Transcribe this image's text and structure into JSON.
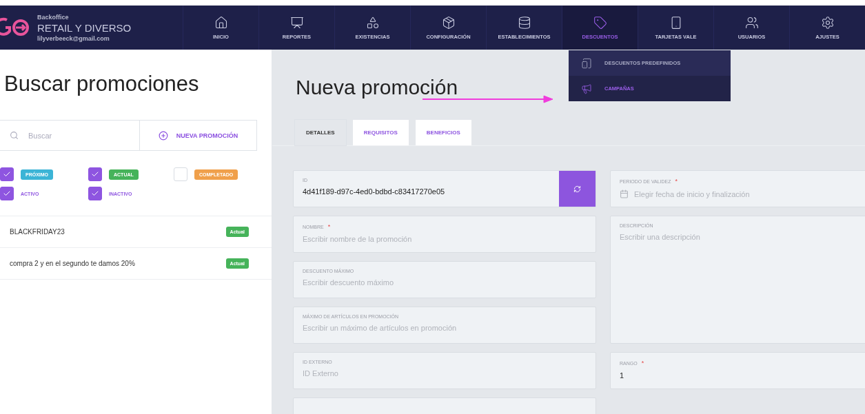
{
  "brand": {
    "subtitle": "Backoffice",
    "title": "RETAIL Y DIVERSO",
    "email": "lilyverbeeck@gmail.com"
  },
  "nav": [
    {
      "label": "INICIO",
      "selected": false
    },
    {
      "label": "REPORTES",
      "selected": false
    },
    {
      "label": "EXISTENCIAS",
      "selected": false
    },
    {
      "label": "CONFIGURACIÓN",
      "selected": false
    },
    {
      "label": "ESTABLECIMIENTOS",
      "selected": false
    },
    {
      "label": "DESCUENTOS",
      "selected": true
    },
    {
      "label": "TARJETAS VALE",
      "selected": false
    },
    {
      "label": "USUARIOS",
      "selected": false
    },
    {
      "label": "AJUSTES",
      "selected": false
    }
  ],
  "dropdown": [
    {
      "label": "DESCUENTOS PREDEFINIDOS",
      "selected": false
    },
    {
      "label": "CAMPAÑAS",
      "selected": true
    }
  ],
  "sidebar": {
    "title": "Buscar promociones",
    "search": {
      "placeholder": "Buscar"
    },
    "new_button": "NUEVA PROMOCIÓN",
    "filters": [
      {
        "label": "PRÓXIMO",
        "checked": true,
        "kind": "tag",
        "color": "#3bb4d6"
      },
      {
        "label": "ACTUAL",
        "checked": true,
        "kind": "tag",
        "color": "#46b35a"
      },
      {
        "label": "COMPLETADO",
        "checked": false,
        "kind": "tag",
        "color": "#f0a04b"
      },
      {
        "label": "ACTIVO",
        "checked": true,
        "kind": "plain"
      },
      {
        "label": "INACTIVO",
        "checked": true,
        "kind": "plain"
      }
    ],
    "promotions": [
      {
        "name": "BLACKFRIDAY23",
        "status": "Actual"
      },
      {
        "name": "compra 2 y en el segundo te damos 20%",
        "status": "Actual"
      }
    ]
  },
  "form": {
    "title": "Nueva promoción",
    "tabs": [
      {
        "label": "DETALLES",
        "selected": true
      },
      {
        "label": "REQUISITOS",
        "selected": false
      },
      {
        "label": "BENEFICIOS",
        "selected": false
      }
    ],
    "left_fields": [
      {
        "kind": "action",
        "label": "ID",
        "value": "4d41f189-d97c-4ed0-bdbd-c83417270e05"
      },
      {
        "kind": "text",
        "label": "NOMBRE",
        "required_mark": "*",
        "placeholder": "Escribir nombre de la promoción"
      },
      {
        "kind": "text",
        "label": "DESCUENTO MÁXIMO",
        "placeholder": "Escribir descuento máximo"
      },
      {
        "kind": "text",
        "label": "MÁXIMO DE ARTÍCULOS EN PROMOCIÓN",
        "placeholder": "Escribir un máximo de artículos en promoción"
      },
      {
        "kind": "text",
        "label": "ID EXTERNO",
        "placeholder": "ID Externo"
      }
    ],
    "right_fields": [
      {
        "kind": "date",
        "label": "PERIODO DE VALIDEZ",
        "required_mark": "*",
        "placeholder": "Elegir fecha de inicio y finalización"
      },
      {
        "kind": "textarea",
        "label": "DESCRIPCIÓN",
        "placeholder": "Escribir una descripción"
      },
      {
        "kind": "text",
        "label": "RANGO",
        "required_mark": "*",
        "value": "1"
      }
    ]
  }
}
